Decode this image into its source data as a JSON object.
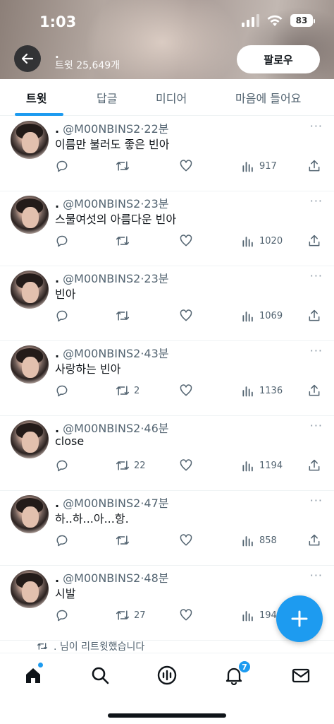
{
  "status_bar": {
    "time": "1:03",
    "battery": "83"
  },
  "header": {
    "name": ".",
    "tweet_count": "트윗 25,649개",
    "follow_label": "팔로우"
  },
  "tabs": [
    {
      "label": "트윗",
      "active": true
    },
    {
      "label": "답글",
      "active": false
    },
    {
      "label": "미디어",
      "active": false
    },
    {
      "label": "마음에 들어요",
      "active": false
    }
  ],
  "tweets": [
    {
      "name": ".",
      "handle": "@M00NBINS2",
      "time": "·22분",
      "text": "이름만 불러도 좋은 빈아",
      "retweets": "",
      "views": "917"
    },
    {
      "name": ".",
      "handle": "@M00NBINS2",
      "time": "·23분",
      "text": "스물여섯의 아름다운 빈아",
      "retweets": "",
      "views": "1020"
    },
    {
      "name": ".",
      "handle": "@M00NBINS2",
      "time": "·23분",
      "text": "빈아",
      "retweets": "",
      "views": "1069"
    },
    {
      "name": ".",
      "handle": "@M00NBINS2",
      "time": "·43분",
      "text": "사랑하는 빈아",
      "retweets": "2",
      "views": "1136"
    },
    {
      "name": ".",
      "handle": "@M00NBINS2",
      "time": "·46분",
      "text": "close",
      "retweets": "22",
      "views": "1194"
    },
    {
      "name": ".",
      "handle": "@M00NBINS2",
      "time": "·47분",
      "text": "하..하...아...항.",
      "retweets": "",
      "views": "858"
    },
    {
      "name": ".",
      "handle": "@M00NBINS2",
      "time": "·48분",
      "text": "시발",
      "retweets": "27",
      "views": "194"
    }
  ],
  "more_label": "···",
  "retweet_note": ". 님이 리트윗했습니다",
  "bottom_nav": {
    "items": [
      "home-icon",
      "search-icon",
      "spaces-icon",
      "notifications-icon",
      "messages-icon"
    ],
    "notification_badge": "7"
  },
  "colors": {
    "accent": "#1d9bf0",
    "text": "#0f1419",
    "muted": "#536471"
  }
}
